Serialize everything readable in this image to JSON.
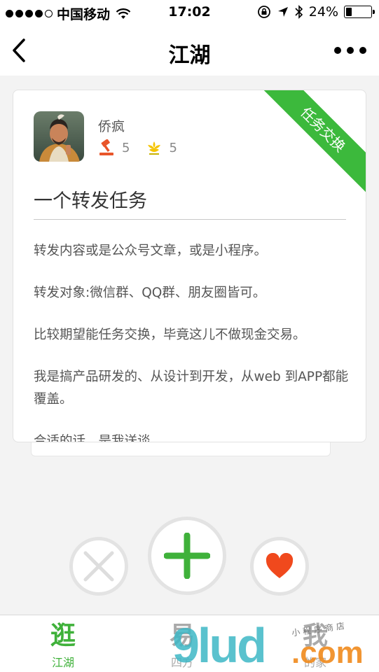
{
  "status_bar": {
    "carrier": "中国移动",
    "time": "17:02",
    "battery": "24%",
    "battery_level": 0.24
  },
  "nav": {
    "title": "江湖"
  },
  "card": {
    "username": "侨疯",
    "stat_hammer": "5",
    "stat_flower": "5",
    "ribbon": "任务交换",
    "title": "一个转发任务",
    "paragraphs": [
      "转发内容或是公众号文章，或是小程序。",
      "转发对象:微信群、QQ群、朋友圈皆可。",
      "比较期望能任务交换，毕竟这儿不做现金交易。",
      "我是搞产品研发的、从设计到开发，从web 到APP都能覆盖。",
      "合适的话，是我送谈"
    ]
  },
  "tabs": [
    {
      "icon": "逛",
      "label": "江湖"
    },
    {
      "icon": "易",
      "label": "四方"
    },
    {
      "icon": "我",
      "label": "的家"
    }
  ],
  "watermark": {
    "brand": "9lud",
    "domain": ".com",
    "slogan": "小程序商店"
  },
  "colors": {
    "accent": "#3fb13a",
    "heart": "#f0491d",
    "hammer": "#e8552a",
    "flower": "#f5c400"
  }
}
